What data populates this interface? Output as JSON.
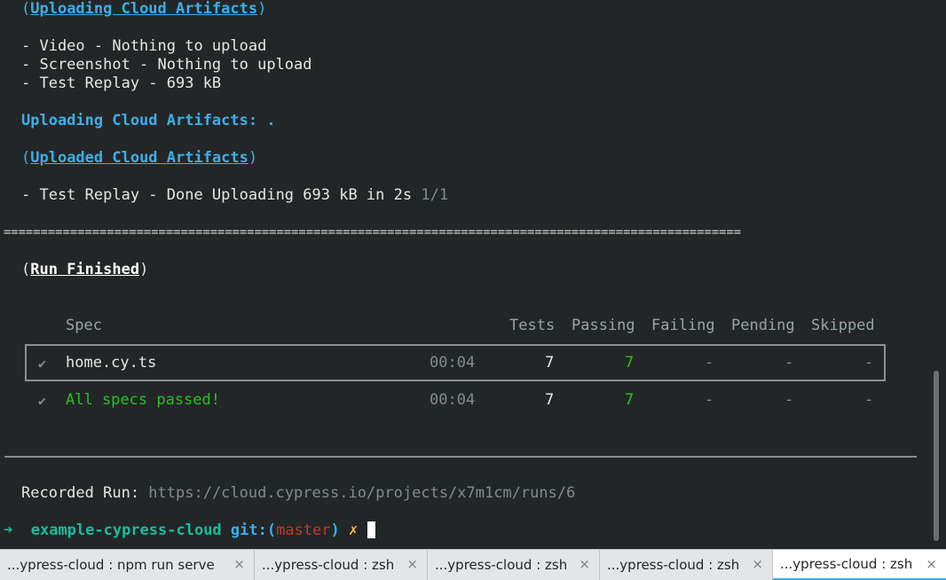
{
  "terminal": {
    "uploading_header_open": "(",
    "uploading_header": "Uploading Cloud Artifacts",
    "uploading_header_close": ")",
    "artifact_lines": [
      "- Video - Nothing to upload",
      "- Screenshot - Nothing to upload",
      "- Test Replay - 693 kB"
    ],
    "uploading_progress": "Uploading Cloud Artifacts: .",
    "uploaded_header_open": "(",
    "uploaded_header": "Uploaded Cloud Artifacts",
    "uploaded_header_close": ")",
    "done_line": "- Test Replay - Done Uploading 693 kB in 2s ",
    "done_count": "1/1",
    "separator": "====================================================================================================",
    "run_finished_open": "(",
    "run_finished": "Run Finished",
    "run_finished_close": ")",
    "table": {
      "headers": {
        "spec": "Spec",
        "tests": "Tests",
        "passing": "Passing",
        "failing": "Failing",
        "pending": "Pending",
        "skipped": "Skipped"
      },
      "rows": [
        {
          "icon": "✔",
          "spec": "home.cy.ts",
          "time": "00:04",
          "tests": "7",
          "passing": "7",
          "failing": "-",
          "pending": "-",
          "skipped": "-"
        },
        {
          "icon": "✔",
          "spec": "All specs passed!",
          "time": "00:04",
          "tests": "7",
          "passing": "7",
          "failing": "-",
          "pending": "-",
          "skipped": "-"
        }
      ]
    },
    "recorded_run_label": "Recorded Run: ",
    "recorded_run_url": "https://cloud.cypress.io/projects/x7m1cm/runs/6",
    "prompt": {
      "arrow": "➜",
      "dir": "example-cypress-cloud",
      "git_label": "git:(",
      "branch": "master",
      "git_close": ")",
      "dirty": "✗"
    }
  },
  "tabs": [
    {
      "label": "...ypress-cloud : npm run serve",
      "close": "×"
    },
    {
      "label": "...ypress-cloud : zsh",
      "close": "×"
    },
    {
      "label": "...ypress-cloud : zsh",
      "close": "×"
    },
    {
      "label": "...ypress-cloud : zsh",
      "close": "×"
    },
    {
      "label": "...ypress-cloud : zsh",
      "close": "×",
      "active": true
    }
  ],
  "colors": {
    "background": "#232627",
    "accent_blue": "#3daee9",
    "success_green": "#27c127",
    "prompt_teal": "#1abc9c",
    "branch_red": "#c0392b",
    "dirty_yellow": "#fdbc4b"
  }
}
